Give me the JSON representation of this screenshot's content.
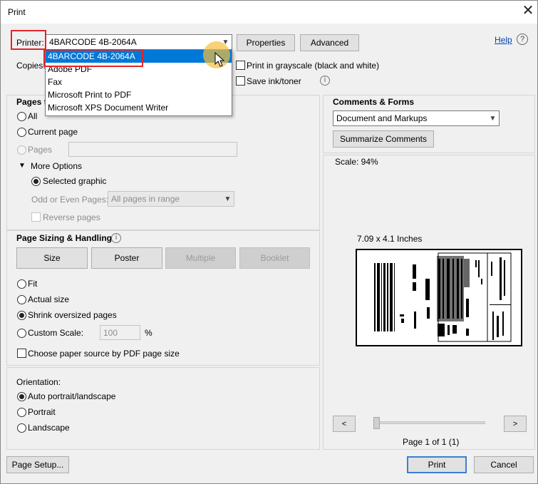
{
  "window": {
    "title": "Print",
    "close_symbol": "✕"
  },
  "printer": {
    "label": "Printer:",
    "selected": "4BARCODE 4B-2064A",
    "options": [
      "4BARCODE 4B-2064A",
      "Adobe PDF",
      "Fax",
      "Microsoft Print to PDF",
      "Microsoft XPS Document Writer"
    ]
  },
  "toolbar": {
    "properties": "Properties",
    "advanced": "Advanced",
    "help": "Help",
    "help_icon": "?"
  },
  "copies": {
    "label": "Copies:"
  },
  "grayscale": {
    "label": "Print in grayscale (black and white)"
  },
  "save_ink": {
    "label": "Save ink/toner",
    "info": "i"
  },
  "pages_to_print": {
    "header": "Pages t",
    "all": "All",
    "current": "Current page",
    "pages": "Pages",
    "more_options": "More Options",
    "selected_graphic": "Selected graphic",
    "odd_even_label": "Odd or Even Pages:",
    "odd_even_value": "All pages in range",
    "reverse": "Reverse pages"
  },
  "sizing": {
    "header": "Page Sizing & Handling",
    "info": "i",
    "tabs": [
      "Size",
      "Poster",
      "Multiple",
      "Booklet"
    ],
    "fit": "Fit",
    "actual": "Actual size",
    "shrink": "Shrink oversized pages",
    "custom": "Custom Scale:",
    "custom_value": "100",
    "percent": "%",
    "paper_source": "Choose paper source by PDF page size"
  },
  "orientation": {
    "header": "Orientation:",
    "auto": "Auto portrait/landscape",
    "portrait": "Portrait",
    "landscape": "Landscape"
  },
  "comments": {
    "header": "Comments & Forms",
    "value": "Document and Markups",
    "summarize": "Summarize Comments"
  },
  "preview": {
    "scale": "Scale:  94%",
    "size": "7.09 x 4.1 Inches",
    "prev": "<",
    "next": ">",
    "page": "Page 1 of 1 (1)"
  },
  "footer": {
    "page_setup": "Page Setup...",
    "print": "Print",
    "cancel": "Cancel"
  }
}
